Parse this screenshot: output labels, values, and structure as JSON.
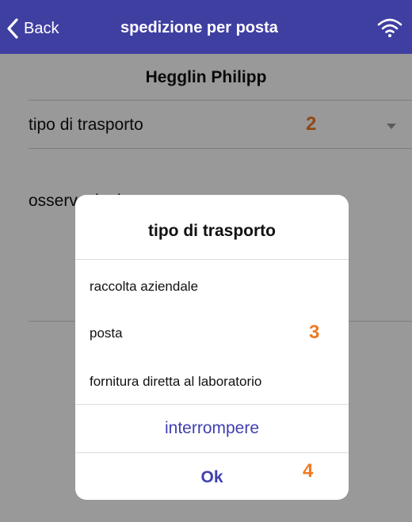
{
  "navbar": {
    "back_label": "Back",
    "title": "spedizione per posta",
    "wifi_icon": "wifi-icon",
    "background": "#3f3fa2"
  },
  "page": {
    "person_name": "Hegglin Philipp",
    "transport_field_label": "tipo di trasporto",
    "notes_field_label": "osservazioni"
  },
  "dialog": {
    "title": "tipo di trasporto",
    "options": [
      "raccolta aziendale",
      "posta",
      "fornitura diretta al laboratorio"
    ],
    "cancel_label": "interrompere",
    "ok_label": "Ok"
  },
  "markers": {
    "m2": "2",
    "m3": "3",
    "m4": "4",
    "color": "#f07a22"
  }
}
